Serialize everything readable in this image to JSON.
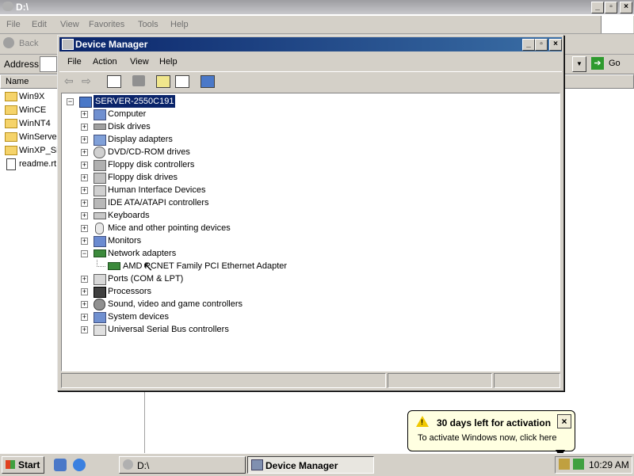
{
  "explorer": {
    "title": "D:\\",
    "menu": [
      "File",
      "Edit",
      "View",
      "Favorites",
      "Tools",
      "Help"
    ],
    "toolbar": {
      "back_label": "Back"
    },
    "address": {
      "label": "Address",
      "go_label": "Go"
    },
    "list": {
      "column_name": "Name",
      "items": [
        "Win9X",
        "WinCE",
        "WinNT4",
        "WinServer",
        "WinXP_Sig",
        "readme.rt"
      ]
    }
  },
  "device_manager": {
    "title": "Device Manager",
    "menu": [
      "File",
      "Action",
      "View",
      "Help"
    ],
    "tree": {
      "root": "SERVER-2550C191",
      "categories": [
        "Computer",
        "Disk drives",
        "Display adapters",
        "DVD/CD-ROM drives",
        "Floppy disk controllers",
        "Floppy disk drives",
        "Human Interface Devices",
        "IDE ATA/ATAPI controllers",
        "Keyboards",
        "Mice and other pointing devices",
        "Monitors",
        "Network adapters",
        "Ports (COM & LPT)",
        "Processors",
        "Sound, video and game controllers",
        "System devices",
        "Universal Serial Bus controllers"
      ],
      "network_child": "AMD PCNET Family PCI Ethernet Adapter"
    }
  },
  "balloon": {
    "title": "30 days left for activation",
    "message": "To activate Windows now, click here"
  },
  "taskbar": {
    "start_label": "Start",
    "windows": [
      "D:\\",
      "Device Manager"
    ],
    "clock": "10:29 AM"
  }
}
